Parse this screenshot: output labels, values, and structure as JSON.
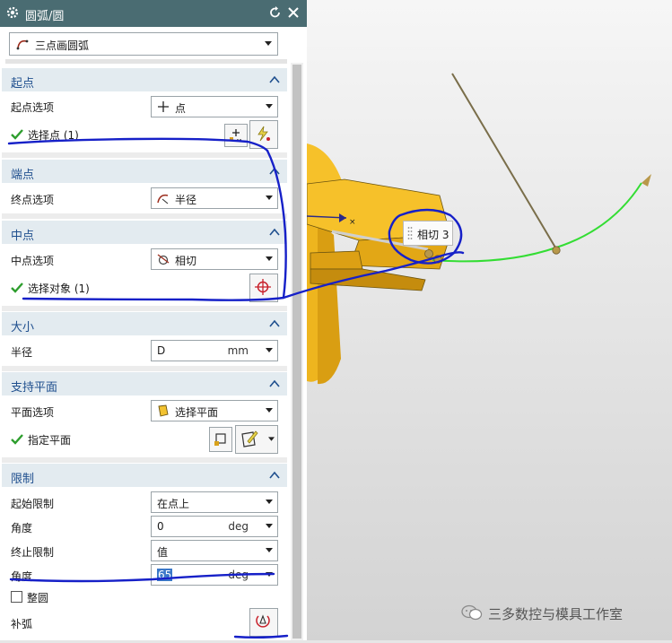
{
  "dialog": {
    "title": "圆弧/圆",
    "type_option": "三点画圆弧"
  },
  "sections": {
    "start": {
      "title": "起点",
      "option_label": "起点选项",
      "option_value": "点",
      "select_label": "选择点 (1)"
    },
    "end": {
      "title": "端点",
      "option_label": "终点选项",
      "option_value": "半径"
    },
    "mid": {
      "title": "中点",
      "option_label": "中点选项",
      "option_value": "相切",
      "select_label": "选择对象 (1)"
    },
    "size": {
      "title": "大小",
      "radius_label": "半径",
      "radius_value": "D",
      "radius_unit": "mm"
    },
    "plane": {
      "title": "支持平面",
      "option_label": "平面选项",
      "option_value": "选择平面",
      "specify_label": "指定平面"
    },
    "limits": {
      "title": "限制",
      "start_limit_label": "起始限制",
      "start_limit_value": "在点上",
      "angle1_label": "角度",
      "angle1_value": "0",
      "angle1_unit": "deg",
      "end_limit_label": "终止限制",
      "end_limit_value": "值",
      "angle2_label": "角度",
      "angle2_value": "65",
      "angle2_unit": "deg",
      "full_circle_label": "整圆",
      "full_circle_checked": false,
      "complement_label": "补弧"
    }
  },
  "viewport": {
    "tooltip": "相切 3"
  },
  "watermark": "三多数控与模具工作室",
  "colors": {
    "titlebar": "#4a6c72",
    "section_title": "#1f4f8e",
    "check": "#2e9e2e",
    "model_yellow": "#f6c12a",
    "arc_green": "#33dd33",
    "annotation_blue": "#1620c8"
  }
}
